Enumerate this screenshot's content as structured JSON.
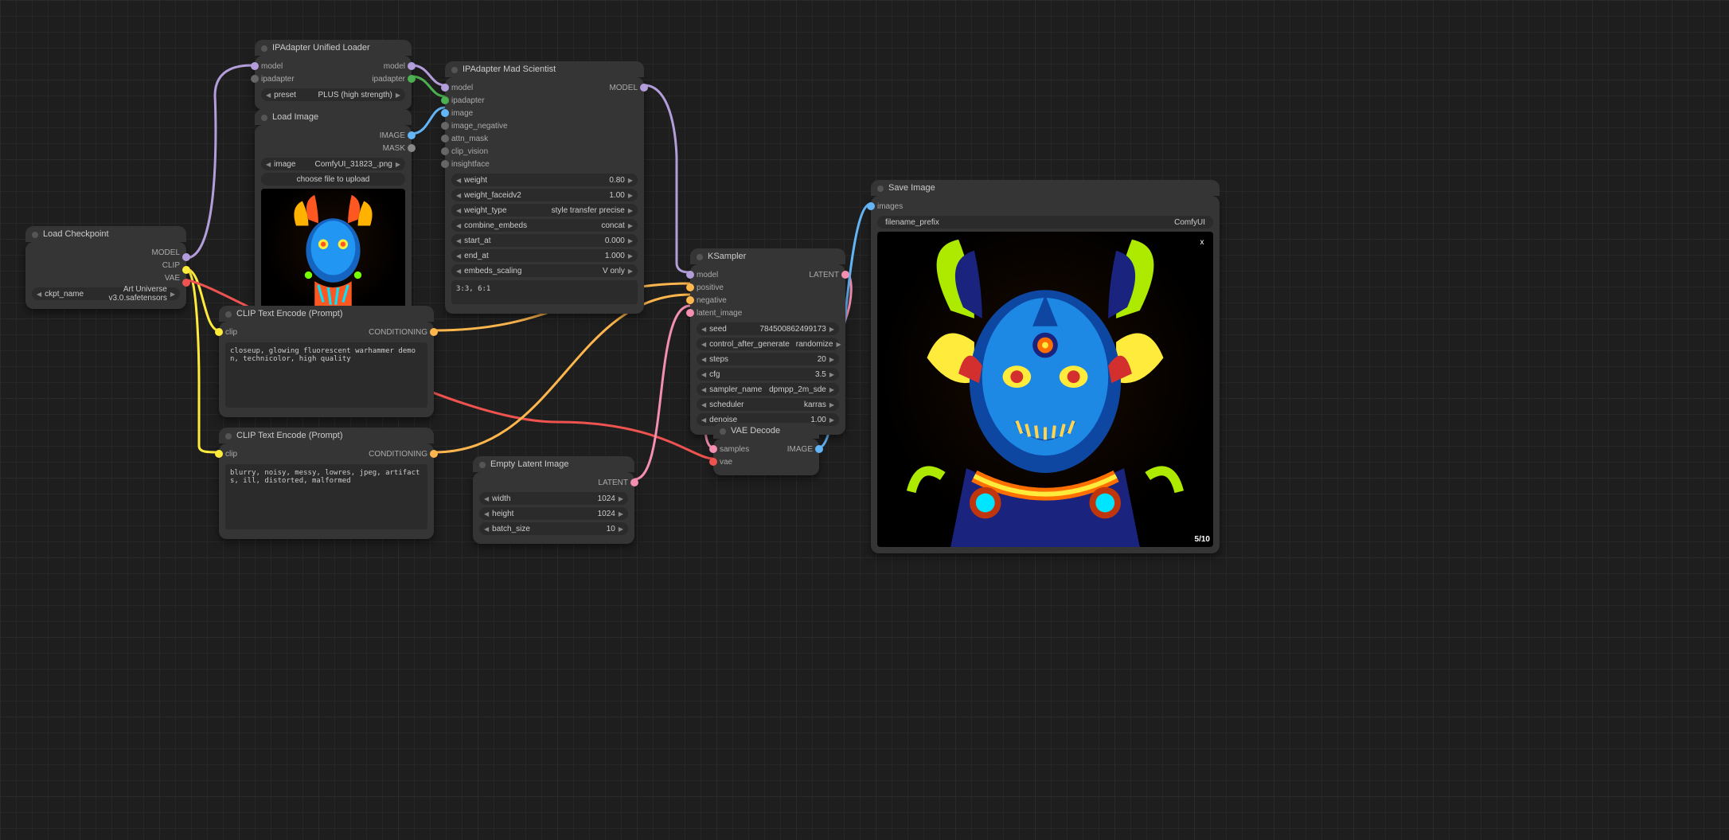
{
  "load_checkpoint": {
    "title": "Load Checkpoint",
    "out_model": "MODEL",
    "out_clip": "CLIP",
    "out_vae": "VAE",
    "ckpt_name_label": "ckpt_name",
    "ckpt_name": "Art Universe v3.0.safetensors"
  },
  "ip_loader": {
    "title": "IPAdapter Unified Loader",
    "in_model": "model",
    "in_ipadapter": "ipadapter",
    "out_model": "model",
    "out_ipadapter": "ipadapter",
    "preset_label": "preset",
    "preset": "PLUS (high strength)"
  },
  "load_image": {
    "title": "Load Image",
    "out_image": "IMAGE",
    "out_mask": "MASK",
    "image_label": "image",
    "image": "ComfyUI_31823_.png",
    "upload": "choose file to upload"
  },
  "ip_mad": {
    "title": "IPAdapter Mad Scientist",
    "in_model": "model",
    "in_ipadapter": "ipadapter",
    "in_image": "image",
    "in_image_neg": "image_negative",
    "in_attn": "attn_mask",
    "in_clipv": "clip_vision",
    "in_insight": "insightface",
    "out_model": "MODEL",
    "weight_label": "weight",
    "weight": "0.80",
    "weight_faceidv2_label": "weight_faceidv2",
    "weight_faceidv2": "1.00",
    "weight_type_label": "weight_type",
    "weight_type": "style transfer precise",
    "combine_embeds_label": "combine_embeds",
    "combine_embeds": "concat",
    "start_at_label": "start_at",
    "start_at": "0.000",
    "end_at_label": "end_at",
    "end_at": "1.000",
    "embeds_scaling_label": "embeds_scaling",
    "embeds_scaling": "V only",
    "layer_weights": "3:3, 6:1"
  },
  "clip_pos": {
    "title": "CLIP Text Encode (Prompt)",
    "in_clip": "clip",
    "out_cond": "CONDITIONING",
    "text": "closeup, glowing fluorescent warhammer demon, technicolor, high quality"
  },
  "clip_neg": {
    "title": "CLIP Text Encode (Prompt)",
    "in_clip": "clip",
    "out_cond": "CONDITIONING",
    "text": "blurry, noisy, messy, lowres, jpeg, artifacts, ill, distorted, malformed"
  },
  "empty_latent": {
    "title": "Empty Latent Image",
    "out_latent": "LATENT",
    "width_label": "width",
    "width": "1024",
    "height_label": "height",
    "height": "1024",
    "batch_label": "batch_size",
    "batch": "10"
  },
  "ksampler": {
    "title": "KSampler",
    "in_model": "model",
    "in_positive": "positive",
    "in_negative": "negative",
    "in_latent": "latent_image",
    "out_latent": "LATENT",
    "seed_label": "seed",
    "seed": "784500862499173",
    "control_label": "control_after_generate",
    "control": "randomize",
    "steps_label": "steps",
    "steps": "20",
    "cfg_label": "cfg",
    "cfg": "3.5",
    "sampler_label": "sampler_name",
    "sampler": "dpmpp_2m_sde",
    "scheduler_label": "scheduler",
    "scheduler": "karras",
    "denoise_label": "denoise",
    "denoise": "1.00"
  },
  "vae_decode": {
    "title": "VAE Decode",
    "in_samples": "samples",
    "in_vae": "vae",
    "out_image": "IMAGE"
  },
  "save_image": {
    "title": "Save Image",
    "in_images": "images",
    "prefix_label": "filename_prefix",
    "prefix": "ComfyUI",
    "counter": "5/10",
    "x": "x"
  },
  "colors": {
    "model": "#b39ddb",
    "ipadapter": "#4caf50",
    "image": "#64b5f6",
    "mask": "#9e9e9e",
    "clip": "#ffeb3b",
    "vae": "#ef5350",
    "cond": "#ffb74d",
    "latent": "#f48fb1"
  }
}
